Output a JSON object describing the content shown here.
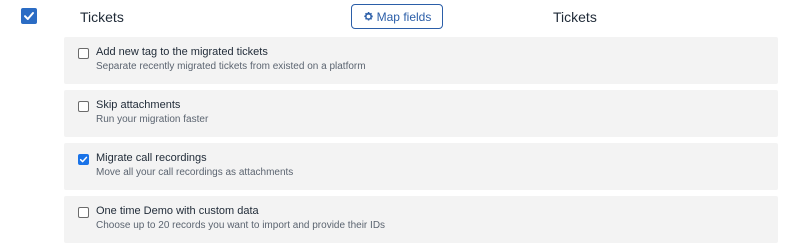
{
  "header": {
    "source_title": "Tickets",
    "target_title": "Tickets",
    "map_fields_label": "Map fields",
    "master_checked": true
  },
  "options": [
    {
      "title": "Add new tag to the migrated tickets",
      "description": "Separate recently migrated tickets from existed on a platform",
      "checked": false
    },
    {
      "title": "Skip attachments",
      "description": "Run your migration faster",
      "checked": false
    },
    {
      "title": "Migrate call recordings",
      "description": "Move all your call recordings as attachments",
      "checked": true
    },
    {
      "title": "One time Demo with custom data",
      "description": "Choose up to 20 records you want to import and provide their IDs",
      "checked": false
    }
  ],
  "colors": {
    "accent": "#2b6cc4",
    "button_border": "#2b5ea8",
    "card_bg": "#f3f3f3"
  },
  "icons": {
    "master_check": "check-icon",
    "map_fields": "gear-icon"
  }
}
